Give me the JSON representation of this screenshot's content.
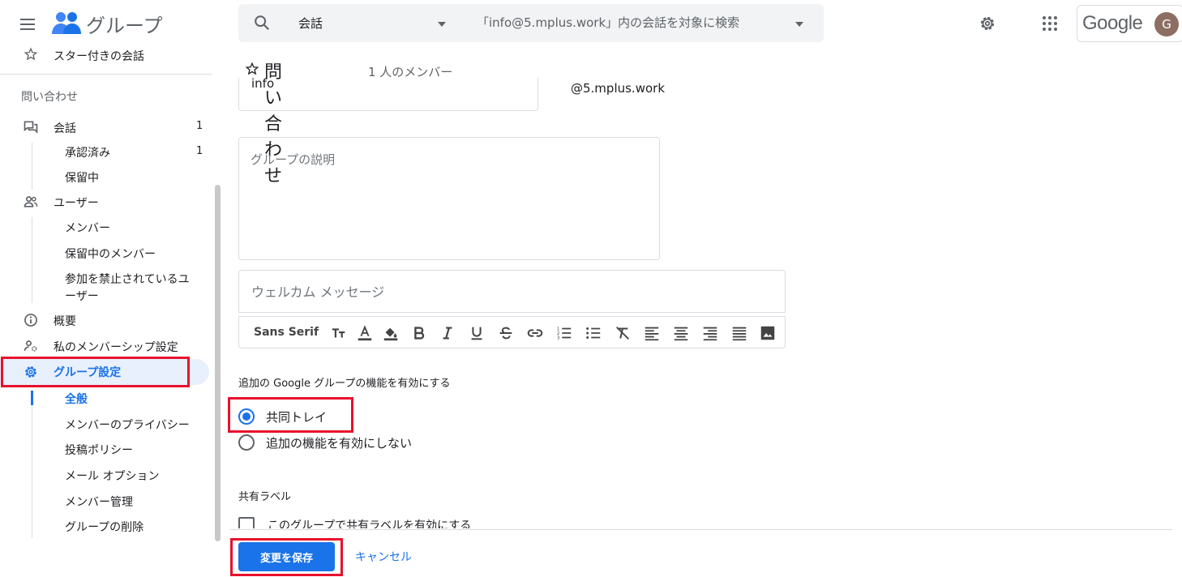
{
  "header": {
    "app_title": "グループ",
    "search_scope": "会話",
    "search_placeholder": "「info@5.mplus.work」内の会話を対象に検索",
    "account_wordmark": "Google",
    "avatar_letter": "G"
  },
  "sidebar": {
    "starred": "スター付きの会話",
    "group_name": "問い合わせ",
    "conversations": {
      "label": "会話",
      "count": "1"
    },
    "conv_subitems": [
      {
        "label": "承認済み",
        "count": "1"
      },
      {
        "label": "保留中"
      }
    ],
    "users": "ユーザー",
    "user_subitems": [
      "メンバー",
      "保留中のメンバー",
      "参加を禁止されているユ",
      "ーザー"
    ],
    "about": "概要",
    "membership": "私のメンバーシップ設定",
    "group_settings": "グループ設定",
    "settings_subitems": [
      "全般",
      "メンバーのプライバシー",
      "投稿ポリシー",
      "メール オプション",
      "メンバー管理",
      "グループの削除"
    ]
  },
  "main": {
    "title": "問い合わせ",
    "member_count": "1 人のメンバー",
    "email_value": "info",
    "email_domain": "@5.mplus.work",
    "description_placeholder": "グループの説明",
    "welcome_placeholder": "ウェルカム メッセージ",
    "font_name": "Sans Serif",
    "features_label": "追加の Google グループの機能を有効にする",
    "feature_options": [
      {
        "label": "共同トレイ",
        "selected": true
      },
      {
        "label": "追加の機能を有効にしない",
        "selected": false
      }
    ],
    "labels_section": "共有ラベル",
    "shared_label_option": "このグループで共有ラベルを有効にする",
    "save_label": "変更を保存",
    "cancel_label": "キャンセル"
  },
  "colors": {
    "accent": "#1a73e8",
    "highlight_box": "#e8112d",
    "active_bg": "#e8f0fe"
  }
}
